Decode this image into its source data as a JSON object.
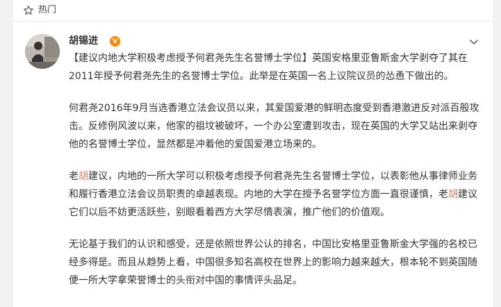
{
  "header": {
    "hot_label": "热门",
    "hot_icon": "star-outline-icon"
  },
  "post": {
    "author": "胡锡进",
    "verified_badge": "V",
    "more_icon": "chevron-down-icon",
    "para1": {
      "topic": "【建议内地大学积极考虑授予何君尧先生名誉博士学位】",
      "text": "英国安格里亚鲁斯金大学剥夺了其在2011年授予何君尧先生的名誉博士学位。此举是在英国一名上议院议员的怂恿下做出的。"
    },
    "para2": "何君尧2016年9月当选香港立法会议员以来，其爱国爱港的鲜明态度受到香港激进反对派百般攻击。反修例风波以来，他家的祖坟被破坏，一个办公室遭到攻击，现在英国的大学又站出来剥夺他的名誉博士学位，显然都是冲着他的爱国爱港立场来的。",
    "para3": {
      "a": "老",
      "hl1": "胡",
      "b": "建议，内地的一所大学可以积极考虑授予何君尧先生名誉博士学位，以表彰他从事律师业务和履行香港立法会议员职责的卓越表现。内地的大学在授予名誉学位方面一直很谨慎，老",
      "hl2": "胡",
      "c": "建议它们以后不妨更活跃些，别眼看着西方大学尽情表演，推广他们的价值观。"
    },
    "para4": "无论基于我们的认识和感受，还是依照世界公认的排名，中国比安格里亚鲁斯金大学强的名校已经多得是。而且从趋势上看，中国很多知名高校在世界上的影响力越来越大，根本轮不到英国随便一所大学拿荣誉博士的头衔对中国的事情评头品足。"
  },
  "colors": {
    "highlight": "#eb7350",
    "badge": "#ff8200"
  }
}
